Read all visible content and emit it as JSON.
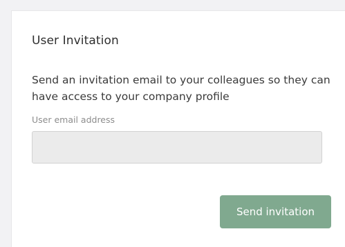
{
  "panel": {
    "title": "User Invitation",
    "description": "Send an invitation email to your colleagues so they can have access to your company profile",
    "email_label": "User email address",
    "email_value": "",
    "email_placeholder": "",
    "send_button_label": "Send invitation"
  },
  "colors": {
    "accent": "#80a98f",
    "input_background": "#ebebeb"
  }
}
